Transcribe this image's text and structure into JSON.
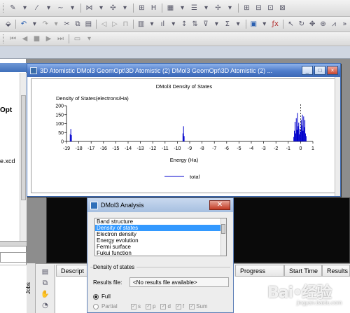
{
  "background_window": {
    "title_suffix": "Opt",
    "file_label": "e.xcd"
  },
  "plot_window": {
    "title": "3D Atomistic DMol3 GeomOpt\\3D Atomistic (2) DMol3 GeomOpt\\3D Atomistic (2) ...",
    "buttons": [
      "_",
      "□",
      "×"
    ]
  },
  "chart_data": {
    "type": "bar",
    "title": "DMol3 Density of States",
    "ylabel": "Density of States(electrons/Ha)",
    "xlabel": "Energy (Ha)",
    "xlim": [
      -19,
      1
    ],
    "ylim": [
      0,
      200
    ],
    "x_ticks": [
      "-19",
      "-18",
      "-17",
      "-16",
      "-15",
      "-14",
      "-13",
      "-12",
      "-11",
      "-10",
      "-9",
      "-8",
      "-7",
      "-6",
      "-5",
      "-4",
      "-3",
      "-2",
      "-1",
      "0",
      "1"
    ],
    "y_ticks": [
      "0",
      "50",
      "100",
      "150",
      "200"
    ],
    "legend_position": "bottom-center",
    "fermi_marker": 0,
    "series": [
      {
        "name": "total",
        "color": "#0000cc",
        "x": [
          -18.7,
          -18.65,
          -18.6,
          -9.55,
          -9.5,
          -9.45,
          -0.55,
          -0.5,
          -0.45,
          -0.4,
          -0.35,
          -0.3,
          -0.25,
          -0.2,
          -0.15,
          -0.1,
          -0.05,
          0.0,
          0.05,
          0.1,
          0.15,
          0.2,
          0.25,
          0.3,
          0.35,
          0.4,
          0.45
        ],
        "values": [
          40,
          70,
          35,
          45,
          85,
          30,
          25,
          60,
          110,
          45,
          130,
          65,
          160,
          85,
          105,
          40,
          70,
          55,
          120,
          90,
          150,
          60,
          140,
          80,
          120,
          45,
          30
        ]
      }
    ]
  },
  "dialog": {
    "title": "DMol3 Analysis",
    "close": "✕",
    "options": [
      "Band structure",
      "Density of states",
      "Electron density",
      "Energy evolution",
      "Fermi surface",
      "Fukui function"
    ],
    "selected_index": 1,
    "section_label": "Density of states",
    "results_file_label": "Results file:",
    "results_file_value": "<No results file available>",
    "full_label": "Full",
    "partial_label": "Partial",
    "orbitals": [
      "s",
      "p",
      "d",
      "f",
      "Sum"
    ]
  },
  "jobs": {
    "side_label": "Jobs",
    "columns": [
      "Descript",
      "Progress",
      "Start Time",
      "Results ..."
    ]
  },
  "watermark": {
    "text": "Bai•经验",
    "sub": "jingyan.baidu.com"
  },
  "colors": {
    "title_blue": "#4e7ccb",
    "selection": "#3399ff",
    "series": "#0000cc"
  }
}
